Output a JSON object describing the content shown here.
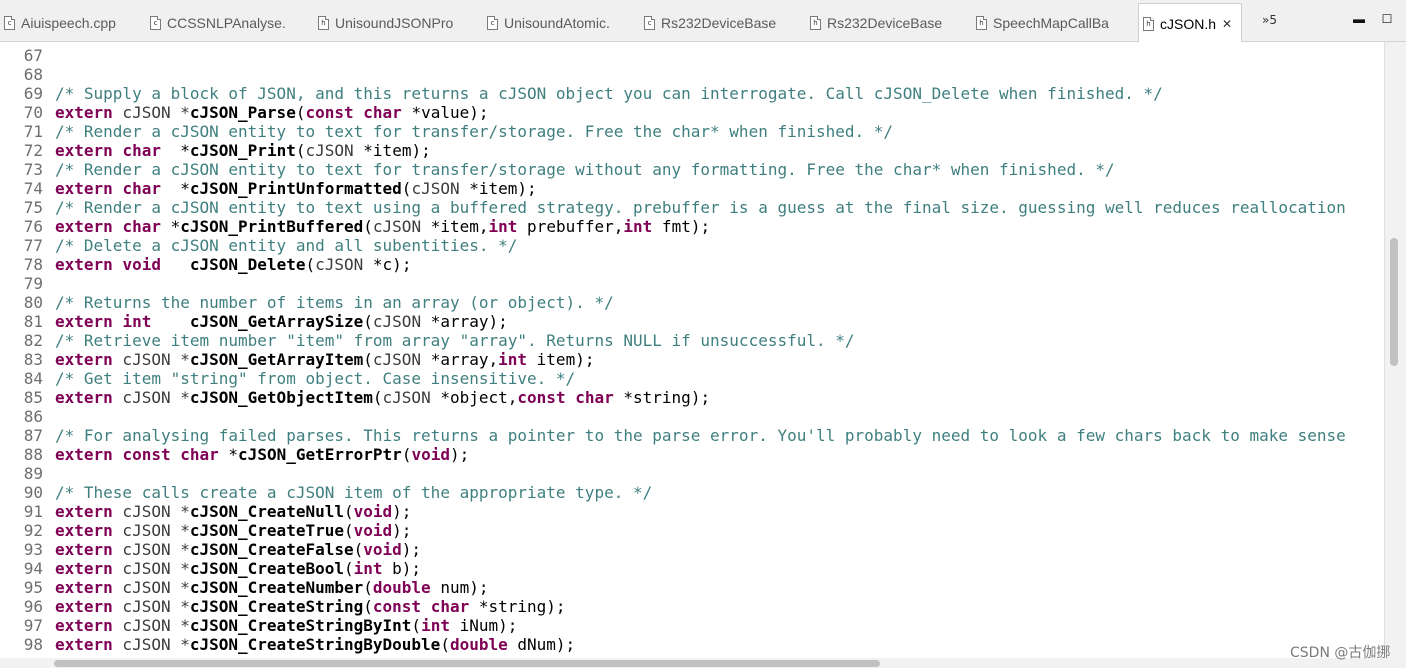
{
  "tabs": [
    {
      "label": "Aiuispeech.cpp",
      "icon": "c"
    },
    {
      "label": "CCSSNLPAnalyse.",
      "icon": "c"
    },
    {
      "label": "UnisoundJSONPro",
      "icon": "h"
    },
    {
      "label": "UnisoundAtomic.",
      "icon": "c"
    },
    {
      "label": "Rs232DeviceBase",
      "icon": "c"
    },
    {
      "label": "Rs232DeviceBase",
      "icon": "h"
    },
    {
      "label": "SpeechMapCallBa",
      "icon": "h"
    },
    {
      "label": "cJSON.h",
      "icon": "h",
      "active": true
    }
  ],
  "tab_overflow": "»5",
  "window_controls": {
    "minimize": "▬",
    "maximize": "☐"
  },
  "editor": {
    "lines": [
      {
        "n": "67",
        "segs": [
          [
            "",
            ""
          ]
        ]
      },
      {
        "n": "68",
        "segs": [
          [
            "",
            ""
          ]
        ]
      },
      {
        "n": "69",
        "segs": [
          [
            "cm",
            "/* Supply a block of JSON, and this returns a cJSON object you can interrogate. Call cJSON_Delete when finished. */"
          ]
        ]
      },
      {
        "n": "70",
        "segs": [
          [
            "kw",
            "extern"
          ],
          [
            "ty",
            " cJSON *"
          ],
          [
            "fn",
            "cJSON_Parse"
          ],
          [
            "",
            "("
          ],
          [
            "kw",
            "const"
          ],
          [
            "",
            " "
          ],
          [
            "kw",
            "char"
          ],
          [
            "",
            " *value);"
          ]
        ]
      },
      {
        "n": "71",
        "segs": [
          [
            "cm",
            "/* Render a cJSON entity to text for transfer/storage. Free the char* when finished. */"
          ]
        ]
      },
      {
        "n": "72",
        "segs": [
          [
            "kw",
            "extern"
          ],
          [
            "",
            " "
          ],
          [
            "kw",
            "char"
          ],
          [
            "",
            "  *"
          ],
          [
            "fn",
            "cJSON_Print"
          ],
          [
            "",
            "("
          ],
          [
            "ty",
            "cJSON"
          ],
          [
            "",
            " *item);"
          ]
        ]
      },
      {
        "n": "73",
        "segs": [
          [
            "cm",
            "/* Render a cJSON entity to text for transfer/storage without any formatting. Free the char* when finished. */"
          ]
        ]
      },
      {
        "n": "74",
        "segs": [
          [
            "kw",
            "extern"
          ],
          [
            "",
            " "
          ],
          [
            "kw",
            "char"
          ],
          [
            "",
            "  *"
          ],
          [
            "fn",
            "cJSON_PrintUnformatted"
          ],
          [
            "",
            "("
          ],
          [
            "ty",
            "cJSON"
          ],
          [
            "",
            " *item);"
          ]
        ]
      },
      {
        "n": "75",
        "segs": [
          [
            "cm",
            "/* Render a cJSON entity to text using a buffered strategy. prebuffer is a guess at the final size. guessing well reduces reallocation"
          ]
        ]
      },
      {
        "n": "76",
        "segs": [
          [
            "kw",
            "extern"
          ],
          [
            "",
            " "
          ],
          [
            "kw",
            "char"
          ],
          [
            "",
            " *"
          ],
          [
            "fn",
            "cJSON_PrintBuffered"
          ],
          [
            "",
            "("
          ],
          [
            "ty",
            "cJSON"
          ],
          [
            "",
            " *item,"
          ],
          [
            "kw",
            "int"
          ],
          [
            "",
            " prebuffer,"
          ],
          [
            "kw",
            "int"
          ],
          [
            "",
            " fmt);"
          ]
        ]
      },
      {
        "n": "77",
        "segs": [
          [
            "cm",
            "/* Delete a cJSON entity and all subentities. */"
          ]
        ]
      },
      {
        "n": "78",
        "segs": [
          [
            "kw",
            "extern"
          ],
          [
            "",
            " "
          ],
          [
            "kw",
            "void"
          ],
          [
            "",
            "   "
          ],
          [
            "fn",
            "cJSON_Delete"
          ],
          [
            "",
            "("
          ],
          [
            "ty",
            "cJSON"
          ],
          [
            "",
            " *c);"
          ]
        ]
      },
      {
        "n": "79",
        "segs": [
          [
            "",
            ""
          ]
        ]
      },
      {
        "n": "80",
        "segs": [
          [
            "cm",
            "/* Returns the number of items in an array (or object). */"
          ]
        ]
      },
      {
        "n": "81",
        "segs": [
          [
            "kw",
            "extern"
          ],
          [
            "",
            " "
          ],
          [
            "kw",
            "int"
          ],
          [
            "",
            "    "
          ],
          [
            "fn",
            "cJSON_GetArraySize"
          ],
          [
            "",
            "("
          ],
          [
            "ty",
            "cJSON"
          ],
          [
            "",
            " *array);"
          ]
        ]
      },
      {
        "n": "82",
        "segs": [
          [
            "cm",
            "/* Retrieve item number \"item\" from array \"array\". Returns NULL if unsuccessful. */"
          ]
        ]
      },
      {
        "n": "83",
        "segs": [
          [
            "kw",
            "extern"
          ],
          [
            "ty",
            " cJSON *"
          ],
          [
            "fn",
            "cJSON_GetArrayItem"
          ],
          [
            "",
            "("
          ],
          [
            "ty",
            "cJSON"
          ],
          [
            "",
            " *array,"
          ],
          [
            "kw",
            "int"
          ],
          [
            "",
            " item);"
          ]
        ]
      },
      {
        "n": "84",
        "segs": [
          [
            "cm",
            "/* Get item \"string\" from object. Case insensitive. */"
          ]
        ]
      },
      {
        "n": "85",
        "segs": [
          [
            "kw",
            "extern"
          ],
          [
            "ty",
            " cJSON *"
          ],
          [
            "fn",
            "cJSON_GetObjectItem"
          ],
          [
            "",
            "("
          ],
          [
            "ty",
            "cJSON"
          ],
          [
            "",
            " *object,"
          ],
          [
            "kw",
            "const"
          ],
          [
            "",
            " "
          ],
          [
            "kw",
            "char"
          ],
          [
            "",
            " *string);"
          ]
        ]
      },
      {
        "n": "86",
        "segs": [
          [
            "",
            ""
          ]
        ]
      },
      {
        "n": "87",
        "segs": [
          [
            "cm",
            "/* For analysing failed parses. This returns a pointer to the parse error. You'll probably need to look a few chars back to make sense"
          ]
        ]
      },
      {
        "n": "88",
        "segs": [
          [
            "kw",
            "extern"
          ],
          [
            "",
            " "
          ],
          [
            "kw",
            "const"
          ],
          [
            "",
            " "
          ],
          [
            "kw",
            "char"
          ],
          [
            "",
            " *"
          ],
          [
            "fn",
            "cJSON_GetErrorPtr"
          ],
          [
            "",
            "("
          ],
          [
            "kw",
            "void"
          ],
          [
            "",
            ");"
          ]
        ]
      },
      {
        "n": "89",
        "segs": [
          [
            "",
            ""
          ]
        ]
      },
      {
        "n": "90",
        "segs": [
          [
            "cm",
            "/* These calls create a cJSON item of the appropriate type. */"
          ]
        ]
      },
      {
        "n": "91",
        "segs": [
          [
            "kw",
            "extern"
          ],
          [
            "ty",
            " cJSON *"
          ],
          [
            "fn",
            "cJSON_CreateNull"
          ],
          [
            "",
            "("
          ],
          [
            "kw",
            "void"
          ],
          [
            "",
            ");"
          ]
        ]
      },
      {
        "n": "92",
        "segs": [
          [
            "kw",
            "extern"
          ],
          [
            "ty",
            " cJSON *"
          ],
          [
            "fn",
            "cJSON_CreateTrue"
          ],
          [
            "",
            "("
          ],
          [
            "kw",
            "void"
          ],
          [
            "",
            ");"
          ]
        ]
      },
      {
        "n": "93",
        "segs": [
          [
            "kw",
            "extern"
          ],
          [
            "ty",
            " cJSON *"
          ],
          [
            "fn",
            "cJSON_CreateFalse"
          ],
          [
            "",
            "("
          ],
          [
            "kw",
            "void"
          ],
          [
            "",
            ");"
          ]
        ]
      },
      {
        "n": "94",
        "segs": [
          [
            "kw",
            "extern"
          ],
          [
            "ty",
            " cJSON *"
          ],
          [
            "fn",
            "cJSON_CreateBool"
          ],
          [
            "",
            "("
          ],
          [
            "kw",
            "int"
          ],
          [
            "",
            " b);"
          ]
        ]
      },
      {
        "n": "95",
        "segs": [
          [
            "kw",
            "extern"
          ],
          [
            "ty",
            " cJSON *"
          ],
          [
            "fn",
            "cJSON_CreateNumber"
          ],
          [
            "",
            "("
          ],
          [
            "kw",
            "double"
          ],
          [
            "",
            " num);"
          ]
        ]
      },
      {
        "n": "96",
        "segs": [
          [
            "kw",
            "extern"
          ],
          [
            "ty",
            " cJSON *"
          ],
          [
            "fn",
            "cJSON_CreateString"
          ],
          [
            "",
            "("
          ],
          [
            "kw",
            "const"
          ],
          [
            "",
            " "
          ],
          [
            "kw",
            "char"
          ],
          [
            "",
            " *string);"
          ]
        ]
      },
      {
        "n": "97",
        "segs": [
          [
            "kw",
            "extern"
          ],
          [
            "ty",
            " cJSON *"
          ],
          [
            "fn",
            "cJSON_CreateStringByInt"
          ],
          [
            "",
            "("
          ],
          [
            "kw",
            "int"
          ],
          [
            "",
            " iNum);"
          ]
        ]
      },
      {
        "n": "98",
        "segs": [
          [
            "kw",
            "extern"
          ],
          [
            "ty",
            " cJSON *"
          ],
          [
            "fn",
            "cJSON_CreateStringByDouble"
          ],
          [
            "",
            "("
          ],
          [
            "kw",
            "double"
          ],
          [
            "",
            " dNum);"
          ]
        ]
      }
    ]
  },
  "watermark": "CSDN @古伽挪",
  "colors": {
    "keyword": "#7f0055",
    "comment": "#3f7f7f",
    "line_number": "#6e6e6e"
  }
}
